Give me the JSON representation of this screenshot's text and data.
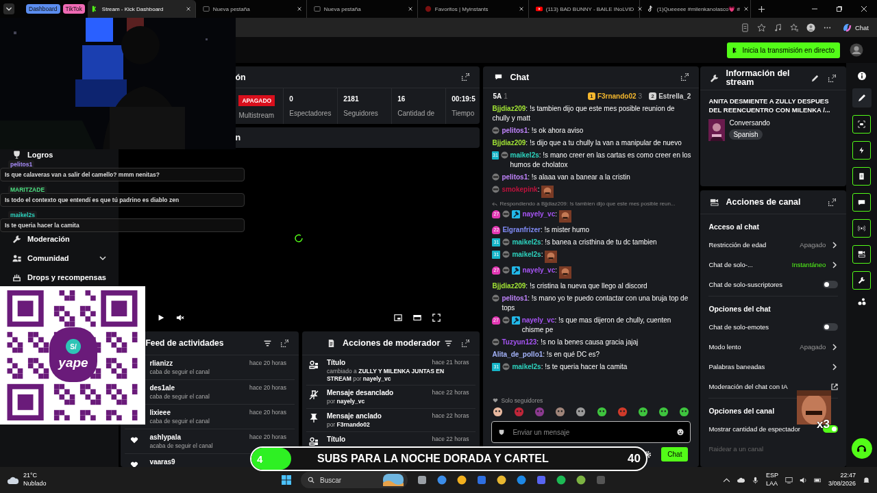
{
  "browser": {
    "tab_groups": [
      {
        "label": "Dashboard",
        "color": "#5b8def"
      },
      {
        "label": "TikTok",
        "color": "#f06ab4"
      }
    ],
    "tabs": [
      {
        "title": "Stream - Kick Dashboard",
        "selected": true,
        "kind": "kick"
      },
      {
        "title": "Nueva pestaña",
        "selected": false,
        "kind": "blank"
      },
      {
        "title": "Nueva pestaña",
        "selected": false,
        "kind": "blank"
      },
      {
        "title": "Favoritos | Myinstants",
        "selected": false,
        "kind": "site"
      },
      {
        "title": "(113) BAD BUNNY - BAILE INoLVID",
        "selected": false,
        "kind": "video"
      },
      {
        "title": "(1)Queeeee #milenkanolasco💗 #",
        "selected": false,
        "kind": "music"
      }
    ],
    "copilot_label": "Chat"
  },
  "header": {
    "go_live": "Inicia la transmisión en directo"
  },
  "sidebar": {
    "items": [
      {
        "label": "Logros",
        "expandable": false
      },
      {
        "label": "Moderación",
        "expandable": false
      },
      {
        "label": "Comunidad",
        "expandable": true
      },
      {
        "label": "Drops y recompensas",
        "expandable": false
      }
    ]
  },
  "stats_panel": {
    "title": "ón",
    "multistream_status": "APAGADO",
    "multistream_label": "Multistream",
    "stats": [
      {
        "value": "0",
        "label": "Espectadores"
      },
      {
        "value": "2181",
        "label": "Seguidores"
      },
      {
        "value": "16",
        "label": "Cantidad de"
      },
      {
        "value": "00:19:5",
        "label": "Tiempo"
      }
    ]
  },
  "player_panel": {
    "title": "n"
  },
  "activity_feed": {
    "title": "Feed de actividades",
    "items": [
      {
        "name": "rlianizz",
        "action": "caba de seguir el canal",
        "time": "hace 20 horas",
        "heart": false
      },
      {
        "name": "des1ale",
        "action": "caba de seguir el canal",
        "time": "hace 20 horas",
        "heart": false
      },
      {
        "name": "lixieee",
        "action": "caba de seguir el canal",
        "time": "hace 20 horas",
        "heart": false
      },
      {
        "name": "ashlypala",
        "action": "acaba de seguir el canal",
        "time": "hace 20 horas",
        "heart": true
      },
      {
        "name": "vaaras9",
        "heart": true
      }
    ]
  },
  "mod_actions": {
    "title": "Acciones de moderador",
    "items": [
      {
        "kind": "title",
        "action": "Título",
        "time": "hace 21 horas",
        "detail": "cambiado a **ZULLY Y MILENKA JUNTAS EN STREAM** por",
        "user": "nayely_vc"
      },
      {
        "kind": "unpin",
        "action": "Mensaje desanclado",
        "time": "hace 22 horas",
        "detail": "por",
        "user": "nayely_vc"
      },
      {
        "kind": "pin",
        "action": "Mensaje anclado",
        "time": "hace 22 horas",
        "detail": "por",
        "user": "F3rnando02"
      },
      {
        "kind": "title",
        "action": "Título",
        "time": "hace 22 horas"
      }
    ]
  },
  "chat": {
    "title": "Chat",
    "leaders": [
      {
        "name": "5A",
        "score": "1"
      },
      {
        "medal": "1",
        "name": "F3rnando02",
        "score": "3",
        "color": "#f5b82e"
      },
      {
        "medal": "2",
        "name": "Estrella_2",
        "color": "#d4d4d4"
      }
    ],
    "messages": [
      {
        "kind": "text",
        "user": "Bjjdiaz209",
        "color": "#a3e635",
        "text": ": !s tambien dijo que este mes posible reunion de chully y matt"
      },
      {
        "kind": "text",
        "user": "pelitos1",
        "color": "#c084fc",
        "badges": [
          {
            "kind": "bot"
          }
        ],
        "text": ": !s ok ahora aviso"
      },
      {
        "kind": "text",
        "user": "Bjjdiaz209",
        "color": "#a3e635",
        "text": ": !s dijo que a tu chully la van a manipular de nuevo"
      },
      {
        "kind": "text",
        "user": "maikel2s",
        "color": "#2dd4bf",
        "badges": [
          {
            "kind": "sub",
            "text": "31"
          },
          {
            "kind": "bot"
          }
        ],
        "text": ": !s mano creer en las cartas es como creer en los humos de cholatox"
      },
      {
        "kind": "text",
        "user": "pelitos1",
        "color": "#c084fc",
        "badges": [
          {
            "kind": "bot"
          }
        ],
        "text": ": !s alaaa van a banear a la cristin"
      },
      {
        "kind": "emote",
        "user": "smokepink",
        "color": "#be123c",
        "text": ":",
        "badges": [
          {
            "kind": "bot"
          }
        ]
      },
      {
        "kind": "emote",
        "user": "nayely_vc",
        "color": "#a855f7",
        "text": ":",
        "reply": "Respondiendo a Bjjdiaz209: !s tambien dijo que este mes posible reun...",
        "badges": [
          {
            "kind": "gift",
            "text": "27"
          },
          {
            "kind": "bot"
          },
          {
            "kind": "mod"
          }
        ]
      },
      {
        "kind": "text",
        "user": "Elgranfrizer",
        "color": "#818cf8",
        "badges": [
          {
            "kind": "gift",
            "text": "22"
          }
        ],
        "text": ": !s mister humo"
      },
      {
        "kind": "text",
        "user": "maikel2s",
        "color": "#2dd4bf",
        "badges": [
          {
            "kind": "sub",
            "text": "31"
          },
          {
            "kind": "bot"
          }
        ],
        "text": ": !s banea a cristhina de tu dc tambien"
      },
      {
        "kind": "emote",
        "user": "maikel2s",
        "color": "#2dd4bf",
        "text": ":",
        "badges": [
          {
            "kind": "sub",
            "text": "31"
          },
          {
            "kind": "bot"
          }
        ]
      },
      {
        "kind": "emote",
        "user": "nayely_vc",
        "color": "#a855f7",
        "text": ":",
        "badges": [
          {
            "kind": "gift",
            "text": "27"
          },
          {
            "kind": "bot"
          },
          {
            "kind": "mod"
          }
        ]
      },
      {
        "kind": "text",
        "user": "Bjjdiaz209",
        "color": "#a3e635",
        "text": ": !s cristina la nueva que llego al discord"
      },
      {
        "kind": "text",
        "user": "pelitos1",
        "color": "#c084fc",
        "badges": [
          {
            "kind": "bot"
          }
        ],
        "text": ": !s mano yo te puedo contactar con una bruja top de tops"
      },
      {
        "kind": "text",
        "user": "nayely_vc",
        "color": "#a855f7",
        "badges": [
          {
            "kind": "gift",
            "text": "27"
          },
          {
            "kind": "bot"
          },
          {
            "kind": "mod"
          }
        ],
        "text": ": !s que mas dijeron de chully, cuenten chisme pe"
      },
      {
        "kind": "text",
        "user": "Tuzyun123",
        "color": "#a855f7",
        "badges": [
          {
            "kind": "bot"
          }
        ],
        "text": ": !s no la benes causa gracia jajaj"
      },
      {
        "kind": "text",
        "user": "Alita_de_pollo1",
        "color": "#a5b4fc",
        "text": ": !s en qué DC es?"
      },
      {
        "kind": "text",
        "user": "maikel2s",
        "color": "#2dd4bf",
        "badges": [
          {
            "kind": "sub",
            "text": "31"
          },
          {
            "kind": "bot"
          }
        ],
        "text": ": !s te queria hacer la camita"
      }
    ],
    "follower_mode": "Solo seguidores",
    "placeholder": "Enviar un mensaje",
    "send_label": "Chat"
  },
  "stream_info": {
    "title": "Información del stream",
    "stream_title": "ANITA DESMIENTE A ZULLY DESPUES DEL REENCUENTRO CON MILENKA /...",
    "category": "Conversando",
    "tag": "Spanish"
  },
  "channel_actions": {
    "title": "Acciones de canal",
    "sections": [
      {
        "heading": "Acceso al chat",
        "rows": [
          {
            "kind": "link",
            "label": "Restricción de edad",
            "value": "Apagado",
            "accent": false
          },
          {
            "kind": "link",
            "label": "Chat de solo-...",
            "value": "Instantáneo",
            "accent": true
          },
          {
            "kind": "toggle",
            "label": "Chat de solo-suscriptores",
            "on": false
          }
        ]
      },
      {
        "heading": "Opciones del chat",
        "rows": [
          {
            "kind": "toggle",
            "label": "Chat de solo-emotes",
            "on": false
          },
          {
            "kind": "link",
            "label": "Modo lento",
            "value": "Apagado",
            "accent": false
          },
          {
            "kind": "link",
            "label": "Palabras baneadas"
          },
          {
            "kind": "external",
            "label": "Moderación del chat con IA"
          }
        ]
      },
      {
        "heading": "Opciones del canal",
        "rows": [
          {
            "kind": "toggle",
            "label": "Mostrar cantidad de espectador",
            "on": true
          },
          {
            "kind": "plain",
            "label": "Raidear a un canal",
            "disabled": true
          }
        ]
      }
    ]
  },
  "overlay_chat": [
    {
      "user": "pelitos1",
      "color": "#a78bfa",
      "text": "Is que calaveras van a salir del camello? mmm nenitas?"
    },
    {
      "user": "MARITZADE",
      "color": "#4ade80",
      "text": "Is todo el contexto que entendí es que tú padrino es diablo zen"
    },
    {
      "user": "maikel2s",
      "color": "#2dd4bf",
      "text": "Is te queria hacer la camita"
    }
  ],
  "qr_card": {
    "symbol": "S/",
    "brand": "yape"
  },
  "goal": {
    "count": "4",
    "label": "SUBS PARA LA NOCHE DORADA Y CARTEL",
    "target": "40",
    "level": 0.1
  },
  "meme": {
    "multiplier": "x3"
  },
  "taskbar": {
    "temperature": "21°C",
    "condition": "Nublado",
    "search": "Buscar",
    "language": "ESP",
    "layout": "LAA",
    "time": "22:47",
    "date": "3/08/2026"
  }
}
